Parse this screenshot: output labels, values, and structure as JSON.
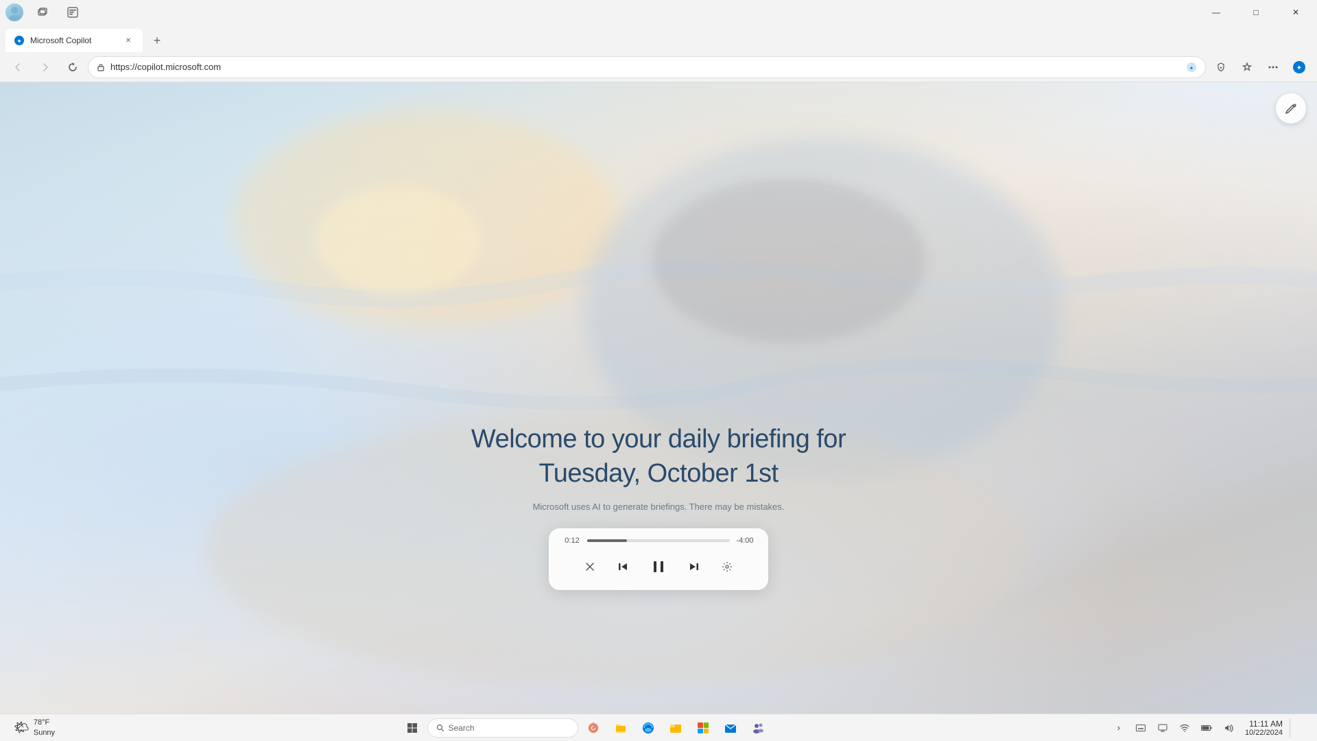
{
  "browser": {
    "url": "https://copilot.microsoft.com",
    "tab_title": "Microsoft Copilot",
    "tab_favicon": "🤖"
  },
  "window_controls": {
    "minimize": "—",
    "maximize": "□",
    "close": "✕"
  },
  "nav": {
    "back_disabled": true,
    "forward_disabled": true,
    "refresh_label": "↻",
    "back_label": "←",
    "forward_label": "→"
  },
  "page": {
    "welcome_line1": "Welcome to your daily briefing for",
    "welcome_line2": "Tuesday, October 1st",
    "ai_disclaimer": "Microsoft uses AI to generate briefings. There may be mistakes.",
    "edit_icon": "✏"
  },
  "audio_player": {
    "current_time": "0:12",
    "remaining_time": "-4:00",
    "progress_percent": 28,
    "close_label": "✕",
    "prev_label": "⏮",
    "play_pause_label": "⏸",
    "next_label": "⏭",
    "settings_label": "⚙"
  },
  "taskbar": {
    "weather_icon": "🌤",
    "temperature": "78°F",
    "condition": "Sunny",
    "windows_icon": "⊞",
    "search_placeholder": "Search",
    "search_icon": "🔍",
    "widgets_icon": "🌸",
    "files_icon": "📁",
    "edge_icon": "🔵",
    "explorer_icon": "📂",
    "browser_icon": "🟧",
    "mail_icon": "📧",
    "teams_icon": "👥",
    "tray_chevron": "›",
    "tray_keyboard": "⌨",
    "tray_wifi": "🛜",
    "tray_battery": "🔋",
    "tray_speaker": "🔊",
    "clock_time": "11:11 AM",
    "clock_date": "10/22/2024",
    "show_desktop": "□"
  }
}
